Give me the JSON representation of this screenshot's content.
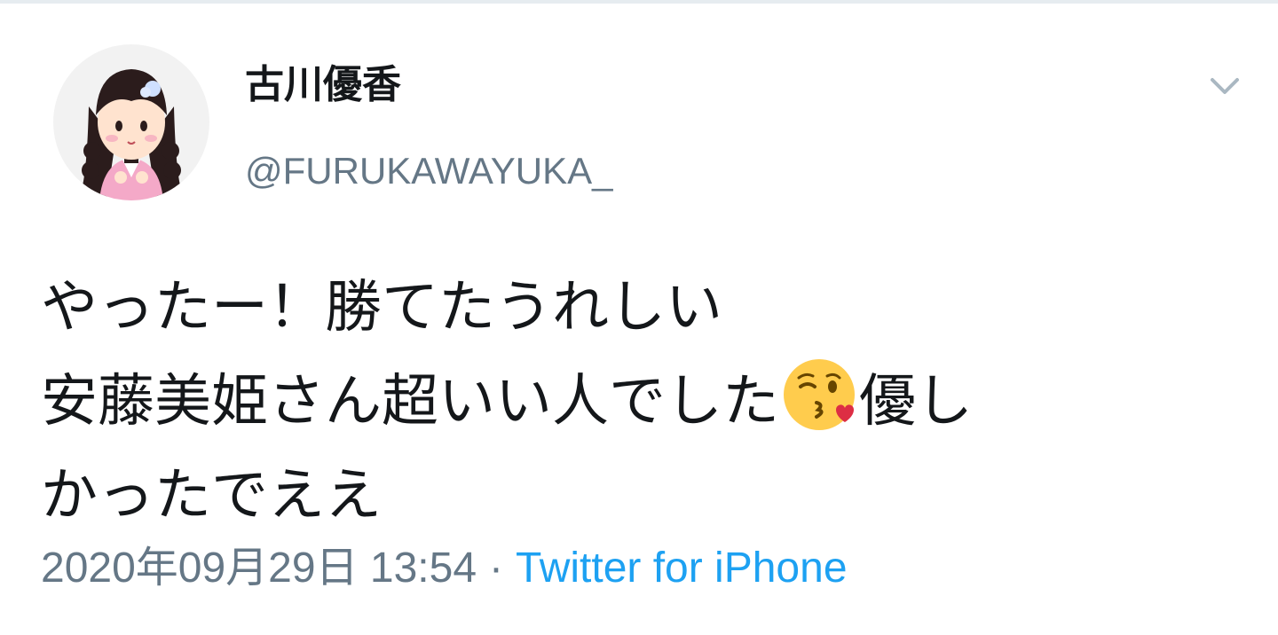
{
  "tweet": {
    "author": {
      "display_name": "古川優香",
      "handle": "@FURUKAWAYUKA_"
    },
    "text_lines": [
      {
        "text": "やったー！勝てたうれしい"
      },
      {
        "before": "安藤美姫さん超いい人でした",
        "emoji": "face-blowing-a-kiss",
        "after": "優し"
      },
      {
        "text": "かったでええ"
      }
    ],
    "timestamp": "2020年09月29日 13:54",
    "separator": "·",
    "source": "Twitter for iPhone"
  },
  "icons": {
    "menu": "chevron-down-icon",
    "avatar": "anime-girl-avatar"
  },
  "colors": {
    "text": "#14171a",
    "secondary": "#657786",
    "link": "#1da1f2"
  }
}
